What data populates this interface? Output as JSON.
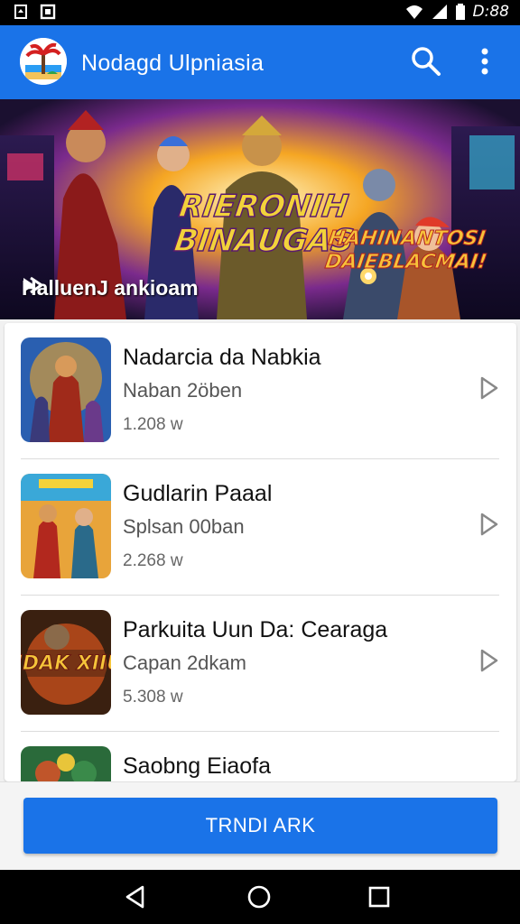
{
  "status_bar": {
    "time": "D:88",
    "icons": [
      "notification-icon",
      "image-icon",
      "wifi-icon",
      "signal-icon",
      "battery-icon"
    ]
  },
  "app_bar": {
    "title": "Nodagd Ulpniasia",
    "logo_icon": "palm-beach-logo",
    "search_icon": "search-icon",
    "more_icon": "more-vert-icon",
    "color": "#1a73e8"
  },
  "banner": {
    "headline": "RIERONIH BINAUGAS",
    "subheadline": "HAHINANTOSI DAIEBLACMAI!",
    "caption": "HalluenJ ankioam",
    "caption_icon": "play-arrow-icon"
  },
  "list": {
    "items": [
      {
        "name": "Nadarcia da Nabkia",
        "subtitle": "Naban 2öben",
        "count": "1.208 w",
        "chevron": "chevron-right-icon"
      },
      {
        "name": "Gudlarin Paaal",
        "subtitle": "Splsan 00ban",
        "count": "2.268 w",
        "chevron": "chevron-right-icon"
      },
      {
        "name": "Parkuita Uun Da: Cearaga",
        "subtitle": "Capan 2dkam",
        "count": "5.308 w",
        "chevron": "chevron-right-icon",
        "thumb_text": "AIIDAK XIIUN"
      },
      {
        "name": "Saobng Eiaofa",
        "subtitle": "",
        "count": ""
      }
    ]
  },
  "cta": {
    "label": "TRNDI ARK"
  },
  "nav": {
    "back_icon": "back-triangle-icon",
    "home_icon": "home-circle-icon",
    "recents_icon": "recents-square-icon"
  }
}
